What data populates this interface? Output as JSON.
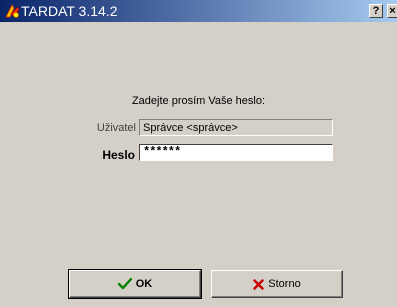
{
  "window": {
    "title": "TARDAT 3.14.2",
    "help_label": "?",
    "close_label": "×",
    "title_gradient": [
      "#0a246a",
      "#a6caf0"
    ]
  },
  "login": {
    "prompt": "Zadejte prosím Vaše heslo:",
    "user_label": "Uživatel",
    "user_value": "Správce <správce>",
    "password_label": "Heslo",
    "password_value": "******"
  },
  "buttons": {
    "ok_label": "OK",
    "ok_icon": "checkmark-icon",
    "ok_icon_color": "#008000",
    "cancel_label": "Storno",
    "cancel_icon": "cross-icon",
    "cancel_icon_color": "#cc0000"
  },
  "colors": {
    "dialog_background": "#d4d0c8"
  }
}
